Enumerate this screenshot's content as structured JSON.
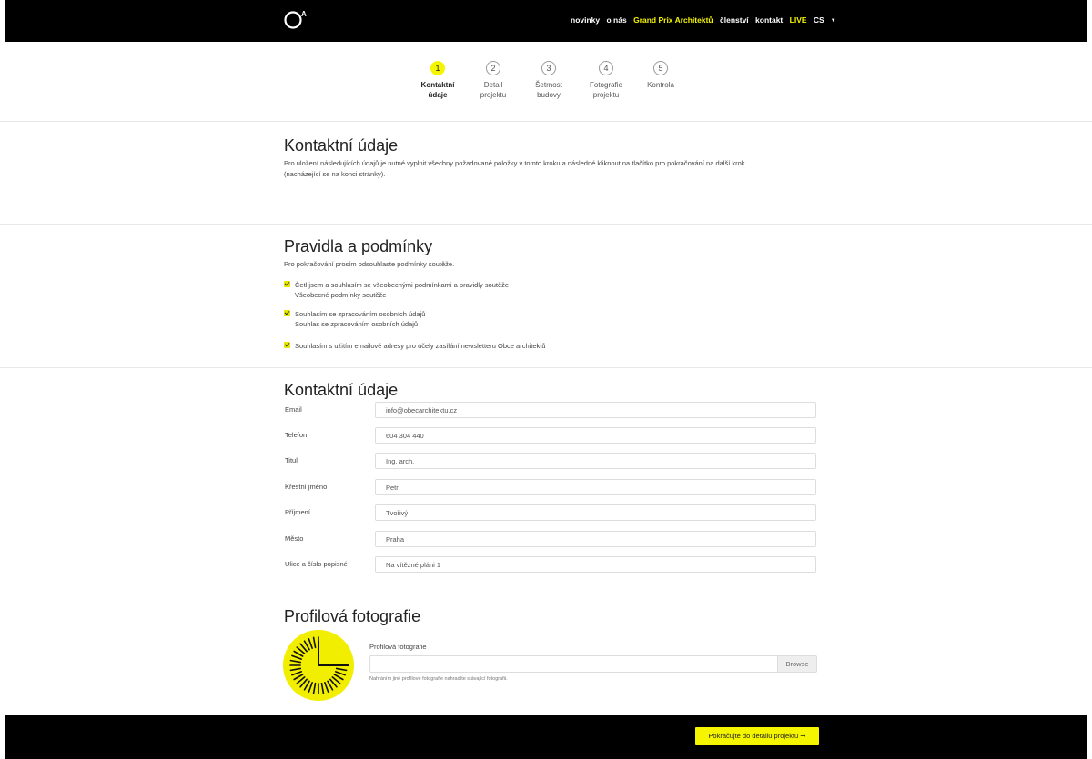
{
  "nav": {
    "items": [
      {
        "label": "novinky"
      },
      {
        "label": "o nás"
      },
      {
        "label": "Grand Prix Architektů"
      },
      {
        "label": "členství"
      },
      {
        "label": "kontakt"
      },
      {
        "label": "LIVE"
      },
      {
        "label": "CS"
      }
    ]
  },
  "steps": [
    {
      "num": "1",
      "line1": "Kontaktní",
      "line2": "údaje"
    },
    {
      "num": "2",
      "line1": "Detail",
      "line2": "projektu"
    },
    {
      "num": "3",
      "line1": "Šetrnost",
      "line2": "budovy"
    },
    {
      "num": "4",
      "line1": "Fotografie",
      "line2": "projektu"
    },
    {
      "num": "5",
      "line1": "Kontrola",
      "line2": ""
    }
  ],
  "intro": {
    "title": "Kontaktní údaje",
    "text_line1": "Pro uložení následujících údajů je nutné vyplnit všechny požadované položky v tomto kroku a následné kliknout na tlačítko pro pokračování na další krok",
    "text_line2": "(nacházející se na konci stránky)."
  },
  "terms": {
    "title": "Pravidla a podmínky",
    "subtitle": "Pro pokračování prosím odsouhlaste podmínky soutěže.",
    "checks": [
      {
        "label": "Četl jsem a souhlasím se všeobecnými podmínkami a pravidly soutěže",
        "sub": "Všeobecné podmínky soutěže"
      },
      {
        "label": "Souhlasím se zpracováním osobních údajů",
        "sub": "Souhlas se zpracováním osobních údajů"
      },
      {
        "label": "Souhlasím s užitím emailové adresy pro účely zasílání newsletteru Obce architektů",
        "sub": ""
      }
    ]
  },
  "contact": {
    "title": "Kontaktní údaje",
    "fields": [
      {
        "label": "Email",
        "value": "info@obecarchitektu.cz"
      },
      {
        "label": "Telefon",
        "value": "604 304 440"
      },
      {
        "label": "Titul",
        "value": "Ing. arch."
      },
      {
        "label": "Křestní jméno",
        "value": "Petr"
      },
      {
        "label": "Příjmení",
        "value": "Tvořivý"
      },
      {
        "label": "Město",
        "value": "Praha"
      },
      {
        "label": "Ulice a číslo popisné",
        "value": "Na vítězné pláni 1"
      }
    ]
  },
  "profile": {
    "title": "Profilová fotografie",
    "label": "Profilová fotografie",
    "browse": "Browse",
    "help": "Nahráním jiné profilové fotografie nahradíte stávající fotografii."
  },
  "footer": {
    "cta": "Pokračujte do detailu projektu ➞"
  },
  "colors": {
    "accent": "#f5f500",
    "bar": "#000000"
  }
}
